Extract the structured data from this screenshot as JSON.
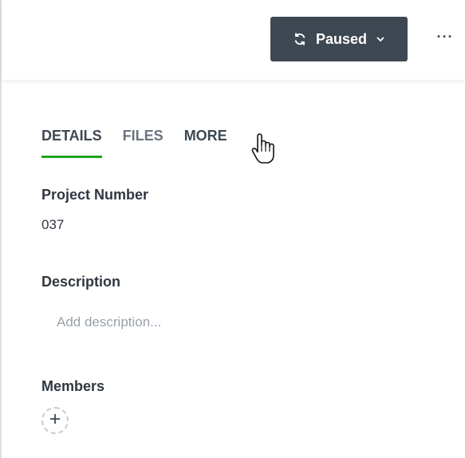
{
  "header": {
    "status_button": {
      "label": "Paused",
      "icon": "sync-icon",
      "dropdown_icon": "chevron-down-icon"
    },
    "more_menu": {
      "label": "···",
      "icon": "more-horizontal-icon"
    }
  },
  "tabs": [
    {
      "label": "DETAILS",
      "active": true
    },
    {
      "label": "FILES",
      "active": false
    },
    {
      "label": "MORE",
      "active": false
    }
  ],
  "fields": {
    "project_number": {
      "label": "Project Number",
      "value": "037"
    },
    "description": {
      "label": "Description",
      "placeholder": "Add description...",
      "value": ""
    },
    "members": {
      "label": "Members",
      "add_icon": "plus-icon"
    }
  },
  "colors": {
    "status_button_bg": "#3d4852",
    "active_tab_underline": "#1ea51e",
    "text": "#2f3740",
    "placeholder": "#9aa1a9"
  }
}
